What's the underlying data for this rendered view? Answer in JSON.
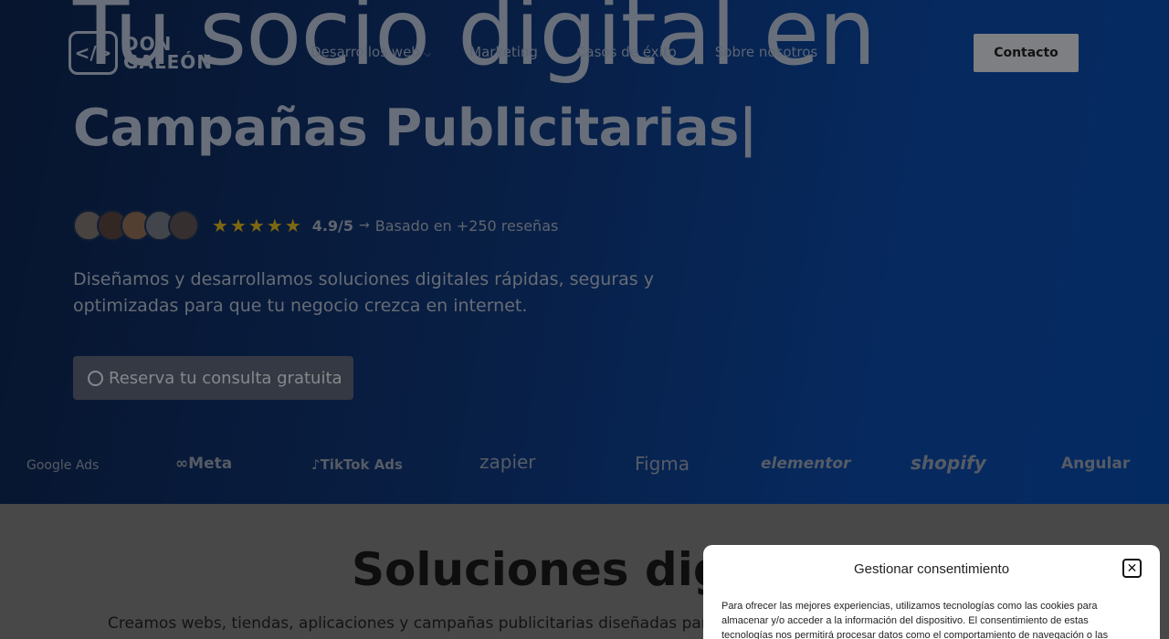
{
  "hero": {
    "headline": "Tu socio digital en",
    "typed_line": "Campañas  Publicitarias|",
    "description": "Diseñamos y desarrollamos soluciones digitales rápidas, seguras y optimizadas para que tu negocio crezca en internet.",
    "cta_label": "Reserva tu consulta gratuita"
  },
  "nav": {
    "logo_line1": "DON",
    "logo_line2": "GALEÓN",
    "logo_symbol": "</>",
    "items": [
      {
        "label": "Desarrollos web",
        "has_dropdown": true
      },
      {
        "label": "Marketing"
      },
      {
        "label": "Casos de éxito"
      },
      {
        "label": "Sobre nosotros"
      }
    ],
    "contact_label": "Contacto"
  },
  "reviews": {
    "rating": "4.9/5",
    "arrow": "→",
    "based_on": "Basado en +250 reseñas",
    "stars": 5
  },
  "brands": [
    "Google Ads",
    "∞Meta",
    "♪TikTok Ads",
    "zapier",
    "Figma",
    "elementor",
    "shopify",
    "Angular"
  ],
  "lower": {
    "title": "Soluciones digi",
    "description": "Creamos webs, tiendas, aplicaciones y campañas publicitarias diseñadas para dar"
  },
  "consent": {
    "title": "Gestionar consentimiento",
    "close_symbol": "✕",
    "text": "Para ofrecer las mejores experiencias, utilizamos tecnologías como las cookies para almacenar y/o acceder a la información del dispositivo. El consentimiento de estas tecnologías nos permitirá procesar datos como el comportamiento de navegación o las"
  },
  "colors": {
    "hero_start": "#0b1f44",
    "hero_end": "#073f91",
    "star": "#b89a1a"
  }
}
